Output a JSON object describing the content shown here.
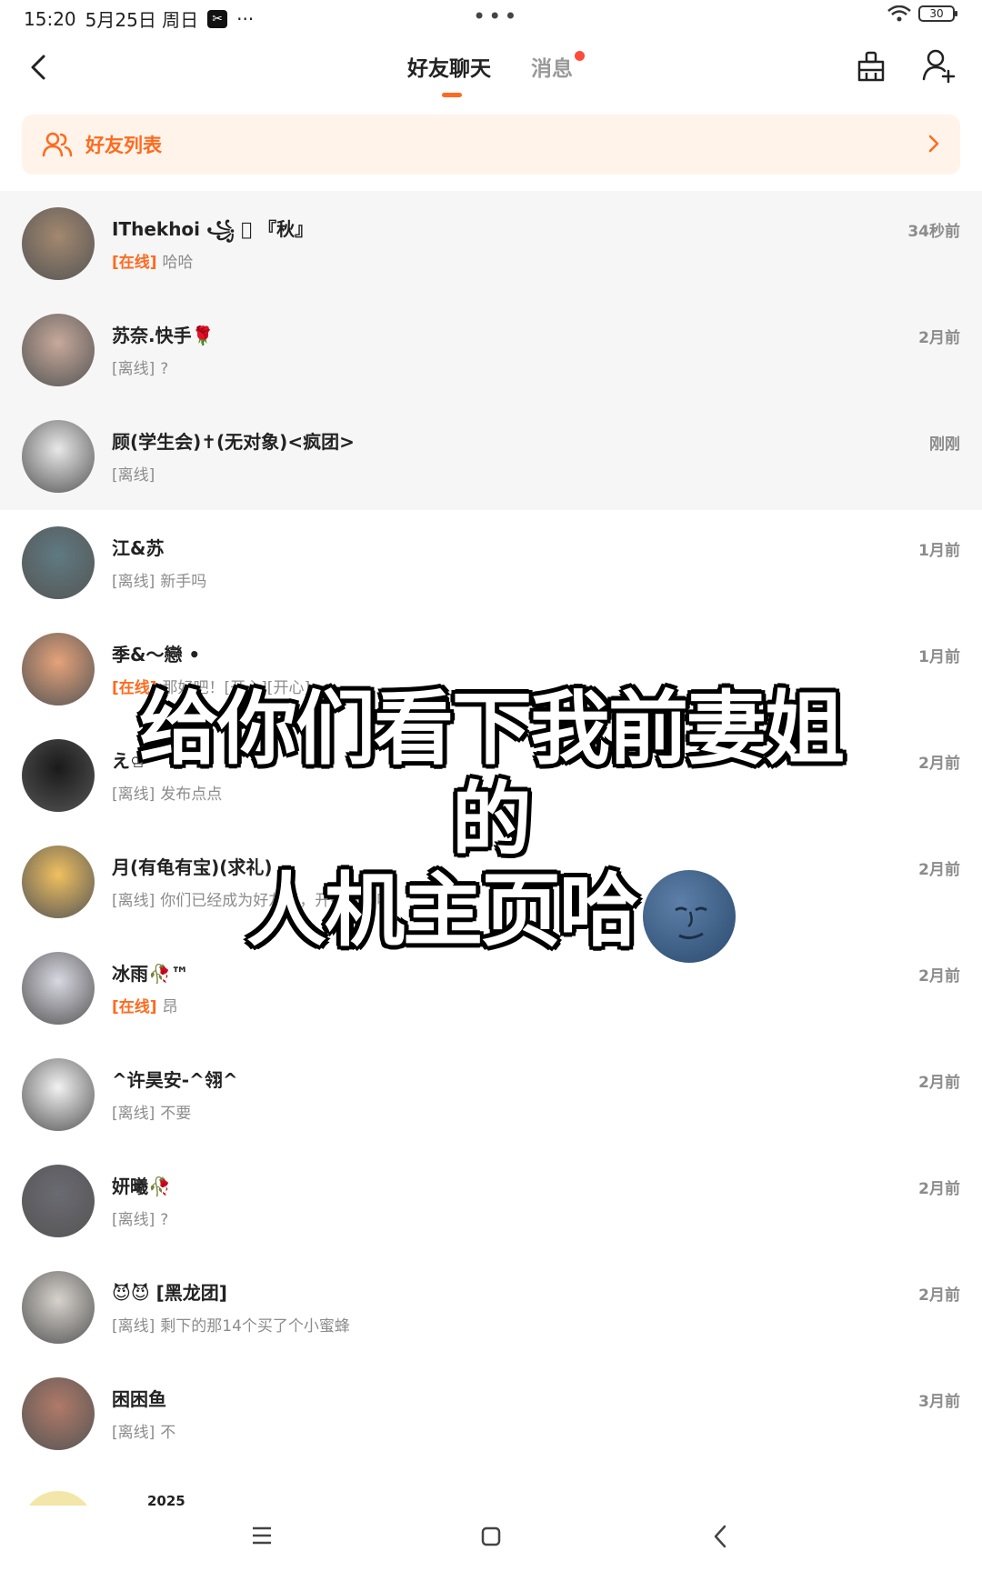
{
  "status_bar": {
    "time": "15:20",
    "date": "5月25日 周日",
    "dots": "•••",
    "battery": "30"
  },
  "header": {
    "tab_friends": "好友聊天",
    "tab_messages": "消息"
  },
  "banner": {
    "label": "好友列表"
  },
  "friends": [
    {
      "name": "IThekhoi ꧁ ⃢ 『秋』",
      "status": "[在线]",
      "online": true,
      "message": "哈哈",
      "time": "34秒前",
      "highlight": true,
      "avatar_color": "#a3886f"
    },
    {
      "name": "苏奈.快手🌹",
      "status": "[离线]",
      "online": false,
      "message": "?",
      "time": "2月前",
      "highlight": true,
      "avatar_color": "#c7a99b"
    },
    {
      "name": "顾(学生会)✝(无对象)<疯团>",
      "status": "[离线]",
      "online": false,
      "message": "",
      "time": "刚刚",
      "highlight": true,
      "avatar_color": "#e8e8e8"
    },
    {
      "name": "江&苏",
      "status": "[离线]",
      "online": false,
      "message": "新手吗",
      "time": "1月前",
      "highlight": false,
      "avatar_color": "#5f7a82"
    },
    {
      "name": "季&～戀 •",
      "status": "[在线]",
      "online": true,
      "message": "那好吧！[开心][开心]",
      "time": "1月前",
      "highlight": false,
      "avatar_color": "#e5a27a"
    },
    {
      "name": "え♔",
      "status": "[离线]",
      "online": false,
      "message": "发布点点",
      "time": "2月前",
      "highlight": false,
      "avatar_color": "#1a1a1a"
    },
    {
      "name": "月(有龟有宝)(求礼)",
      "status": "[离线]",
      "online": false,
      "message": "你们已经成为好友了，开始聊天吧",
      "time": "2月前",
      "highlight": false,
      "avatar_color": "#f0c060"
    },
    {
      "name": "冰雨🥀™",
      "status": "[在线]",
      "online": true,
      "message": "昂",
      "time": "2月前",
      "highlight": false,
      "avatar_color": "#d8d8e2"
    },
    {
      "name": "^许昊安-^翎^",
      "status": "[离线]",
      "online": false,
      "message": "不要",
      "time": "2月前",
      "highlight": false,
      "avatar_color": "#f2f2f2"
    },
    {
      "name": "妍曦🥀",
      "status": "[离线]",
      "online": false,
      "message": "?",
      "time": "2月前",
      "highlight": false,
      "avatar_color": "#6a6a72"
    },
    {
      "name": "😈😈 [黑龙团]",
      "status": "[离线]",
      "online": false,
      "message": "剩下的那14个买了个小蜜蜂",
      "time": "2月前",
      "highlight": false,
      "avatar_color": "#d7d2cc"
    },
    {
      "name": "困困鱼",
      "status": "[离线]",
      "online": false,
      "message": "不",
      "time": "3月前",
      "highlight": false,
      "avatar_color": "#b07a68"
    }
  ],
  "overlay": {
    "line1": "给你们看下我前妻姐的",
    "line2": "人机主页哈"
  },
  "partial_row": {
    "name": "2025"
  },
  "colors": {
    "accent": "#ff6a1f",
    "banner_bg": "#fff3ea",
    "muted": "#8c8c8c"
  }
}
